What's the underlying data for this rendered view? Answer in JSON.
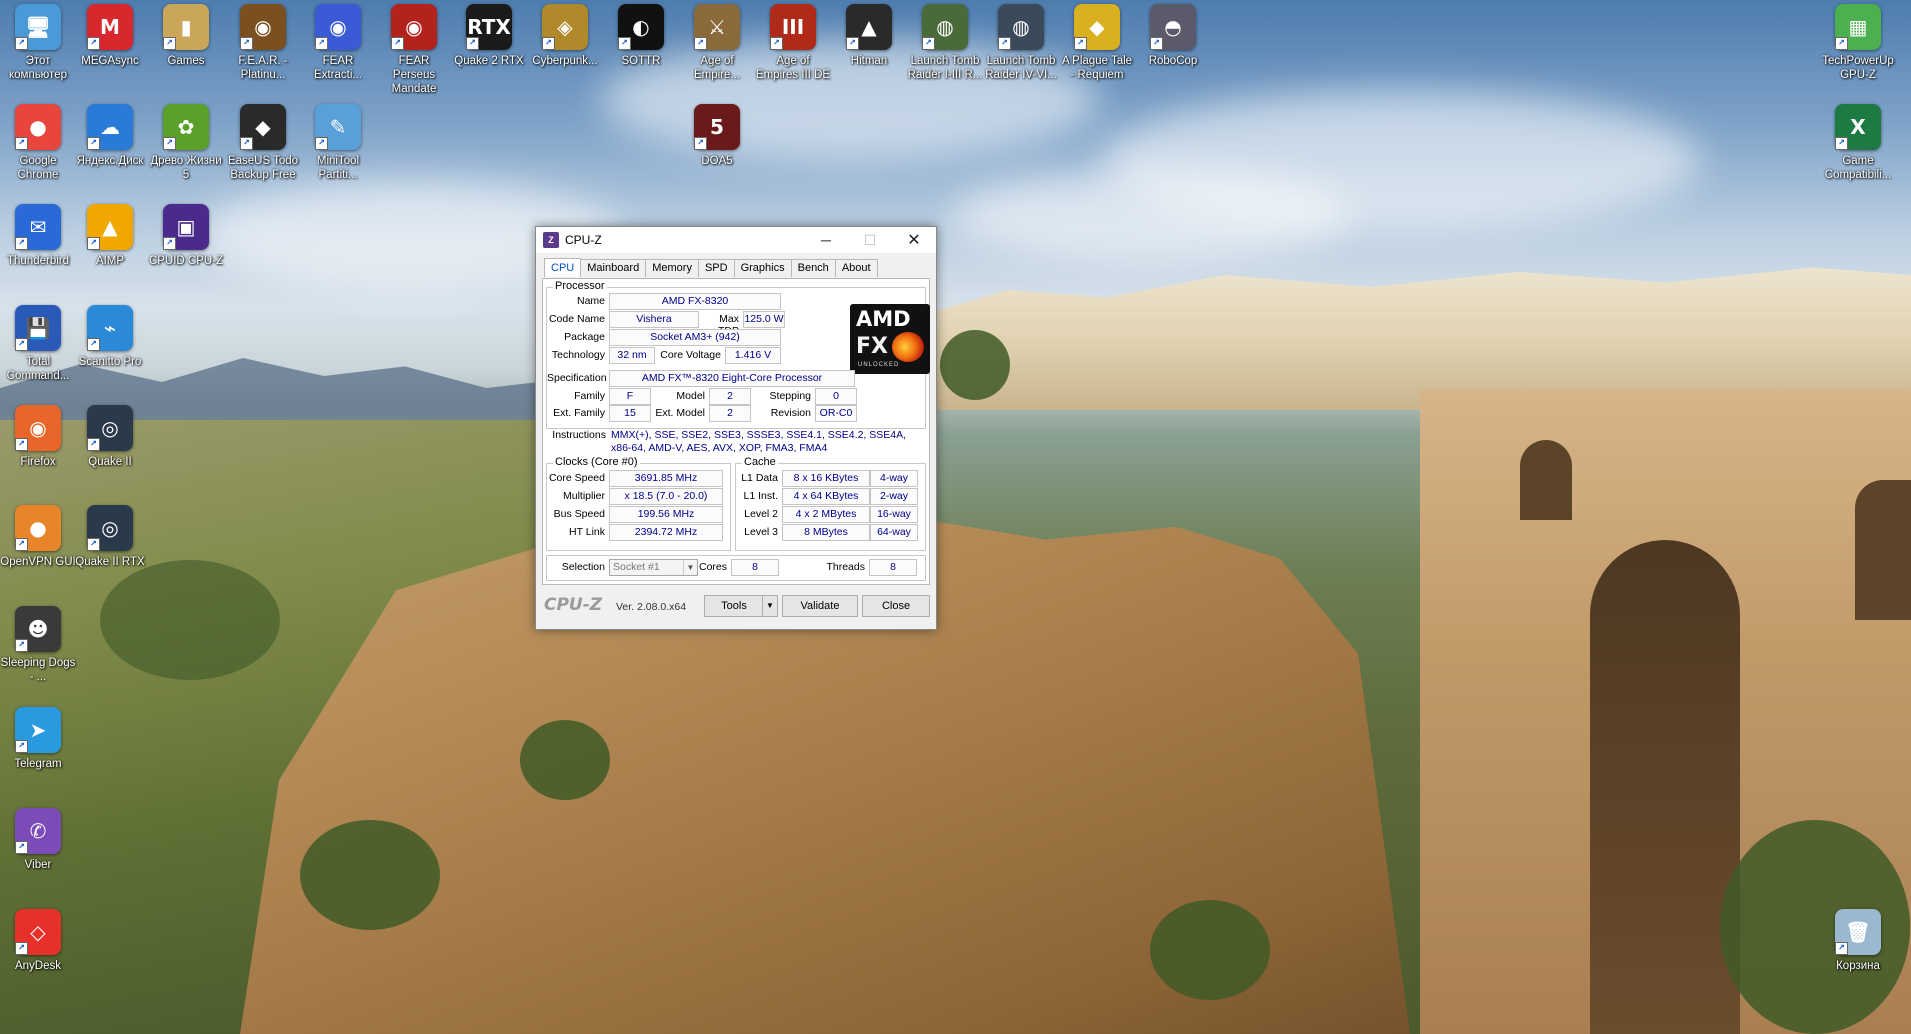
{
  "desktop": {
    "icons": [
      {
        "label": "Этот компьютер",
        "glyph": "🖥",
        "color": "#4a9ad8"
      },
      {
        "label": "MEGAsync",
        "glyph": "M",
        "color": "#d9272e"
      },
      {
        "label": "Games",
        "glyph": "▮",
        "color": "#c9a65a"
      },
      {
        "label": "F.E.A.R. - Platinu...",
        "glyph": "◉",
        "color": "#7a5020"
      },
      {
        "label": "FEAR Extracti...",
        "glyph": "◉",
        "color": "#3b5bd6"
      },
      {
        "label": "FEAR Perseus Mandate",
        "glyph": "◉",
        "color": "#b3231c"
      },
      {
        "label": "Quake 2 RTX",
        "glyph": "RTX",
        "color": "#1b1b1b"
      },
      {
        "label": "Cyberpunk...",
        "glyph": "◈",
        "color": "#b08a2a"
      },
      {
        "label": "SOTTR",
        "glyph": "◐",
        "color": "#111111"
      },
      {
        "label": "Age of Empire...",
        "glyph": "⚔",
        "color": "#8a6a3a"
      },
      {
        "label": "Age of Empires III DE",
        "glyph": "III",
        "color": "#b02a1a"
      },
      {
        "label": "Hitman",
        "glyph": "▲",
        "color": "#2a2a2a"
      },
      {
        "label": "Launch Tomb Raider I-III R...",
        "glyph": "◍",
        "color": "#4a6a3a"
      },
      {
        "label": "Launch Tomb Raider IV-VI...",
        "glyph": "◍",
        "color": "#3a4a5a"
      },
      {
        "label": "A Plague Tale - Requiem",
        "glyph": "◆",
        "color": "#d9b020"
      },
      {
        "label": "RoboCop",
        "glyph": "◓",
        "color": "#5a5a6a"
      },
      {
        "label": "DOA5",
        "glyph": "5",
        "color": "#6a1a1a"
      },
      {
        "label": "TechPowerUp GPU-Z",
        "glyph": "▦",
        "color": "#4caf50"
      },
      {
        "label": "Google Chrome",
        "glyph": "●",
        "color": "#e8453c"
      },
      {
        "label": "Яндекс.Диск",
        "glyph": "☁",
        "color": "#2a7ad8"
      },
      {
        "label": "Древо Жизни 5",
        "glyph": "✿",
        "color": "#5aa02a"
      },
      {
        "label": "EaseUS Todo Backup Free",
        "glyph": "◆",
        "color": "#2a2a2a"
      },
      {
        "label": "MiniTool Partiti...",
        "glyph": "✎",
        "color": "#5aa0d8"
      },
      {
        "label": "Game Compatibili...",
        "glyph": "X",
        "color": "#1d7a43"
      },
      {
        "label": "Thunderbird",
        "glyph": "✉",
        "color": "#2a6ad8"
      },
      {
        "label": "AIMP",
        "glyph": "▲",
        "color": "#f0a800"
      },
      {
        "label": "CPUID CPU-Z",
        "glyph": "▣",
        "color": "#4a2a8a"
      },
      {
        "label": "Total Command...",
        "glyph": "💾",
        "color": "#2a5ab8"
      },
      {
        "label": "Scanitto Pro",
        "glyph": "⌁",
        "color": "#2a8ad8"
      },
      {
        "label": "Firefox",
        "glyph": "◉",
        "color": "#e8662a"
      },
      {
        "label": "Quake II",
        "glyph": "◎",
        "color": "#2a3a4a"
      },
      {
        "label": "OpenVPN GUI",
        "glyph": "●",
        "color": "#e8842a"
      },
      {
        "label": "Quake II RTX",
        "glyph": "◎",
        "color": "#2a3a4a"
      },
      {
        "label": "Sleeping Dogs - ...",
        "glyph": "☻",
        "color": "#3a3a3a"
      },
      {
        "label": "Telegram",
        "glyph": "➤",
        "color": "#2a9ae0"
      },
      {
        "label": "Viber",
        "glyph": "✆",
        "color": "#7b4bb8"
      },
      {
        "label": "AnyDesk",
        "glyph": "◇",
        "color": "#e8302a"
      },
      {
        "label": "Корзина",
        "glyph": "🗑",
        "color": "#9ab8d0"
      }
    ]
  },
  "window": {
    "title": "CPU-Z",
    "controls": {
      "minimize": "─",
      "maximize": "☐",
      "close": "✕"
    },
    "tabs": [
      "CPU",
      "Mainboard",
      "Memory",
      "SPD",
      "Graphics",
      "Bench",
      "About"
    ],
    "processor": {
      "group_title": "Processor",
      "name_label": "Name",
      "name": "AMD FX-8320",
      "codename_label": "Code Name",
      "codename": "Vishera",
      "maxtdp_label": "Max TDP",
      "maxtdp": "125.0 W",
      "package_label": "Package",
      "package": "Socket AM3+ (942)",
      "technology_label": "Technology",
      "technology": "32 nm",
      "corevoltage_label": "Core Voltage",
      "corevoltage": "1.416 V",
      "spec_label": "Specification",
      "spec": "AMD FX™-8320 Eight-Core Processor",
      "family_label": "Family",
      "family": "F",
      "model_label": "Model",
      "model": "2",
      "stepping_label": "Stepping",
      "stepping": "0",
      "extfamily_label": "Ext. Family",
      "extfamily": "15",
      "extmodel_label": "Ext. Model",
      "extmodel": "2",
      "revision_label": "Revision",
      "revision": "OR-C0",
      "instructions_label": "Instructions",
      "instructions_line1": "MMX(+), SSE, SSE2, SSE3, SSSE3, SSE4.1, SSE4.2, SSE4A,",
      "instructions_line2": "x86-64, AMD-V, AES, AVX, XOP, FMA3, FMA4",
      "logo_amd": "AMD",
      "logo_fx": "FX",
      "logo_unlocked": "UNLOCKED"
    },
    "clocks": {
      "group_title": "Clocks (Core #0)",
      "corespeed_label": "Core Speed",
      "corespeed": "3691.85 MHz",
      "multiplier_label": "Multiplier",
      "multiplier": "x 18.5 (7.0 - 20.0)",
      "busspeed_label": "Bus Speed",
      "busspeed": "199.56 MHz",
      "htlink_label": "HT Link",
      "htlink": "2394.72 MHz"
    },
    "cache": {
      "group_title": "Cache",
      "l1data_label": "L1 Data",
      "l1data": "8 x 16 KBytes",
      "l1data_way": "4-way",
      "l1inst_label": "L1 Inst.",
      "l1inst": "4 x 64 KBytes",
      "l1inst_way": "2-way",
      "level2_label": "Level 2",
      "level2": "4 x 2 MBytes",
      "level2_way": "16-way",
      "level3_label": "Level 3",
      "level3": "8 MBytes",
      "level3_way": "64-way"
    },
    "selection": {
      "label": "Selection",
      "value": "Socket #1",
      "cores_label": "Cores",
      "cores": "8",
      "threads_label": "Threads",
      "threads": "8"
    },
    "footer": {
      "brand": "CPU-Z",
      "version": "Ver. 2.08.0.x64",
      "tools": "Tools",
      "validate": "Validate",
      "close": "Close"
    }
  }
}
